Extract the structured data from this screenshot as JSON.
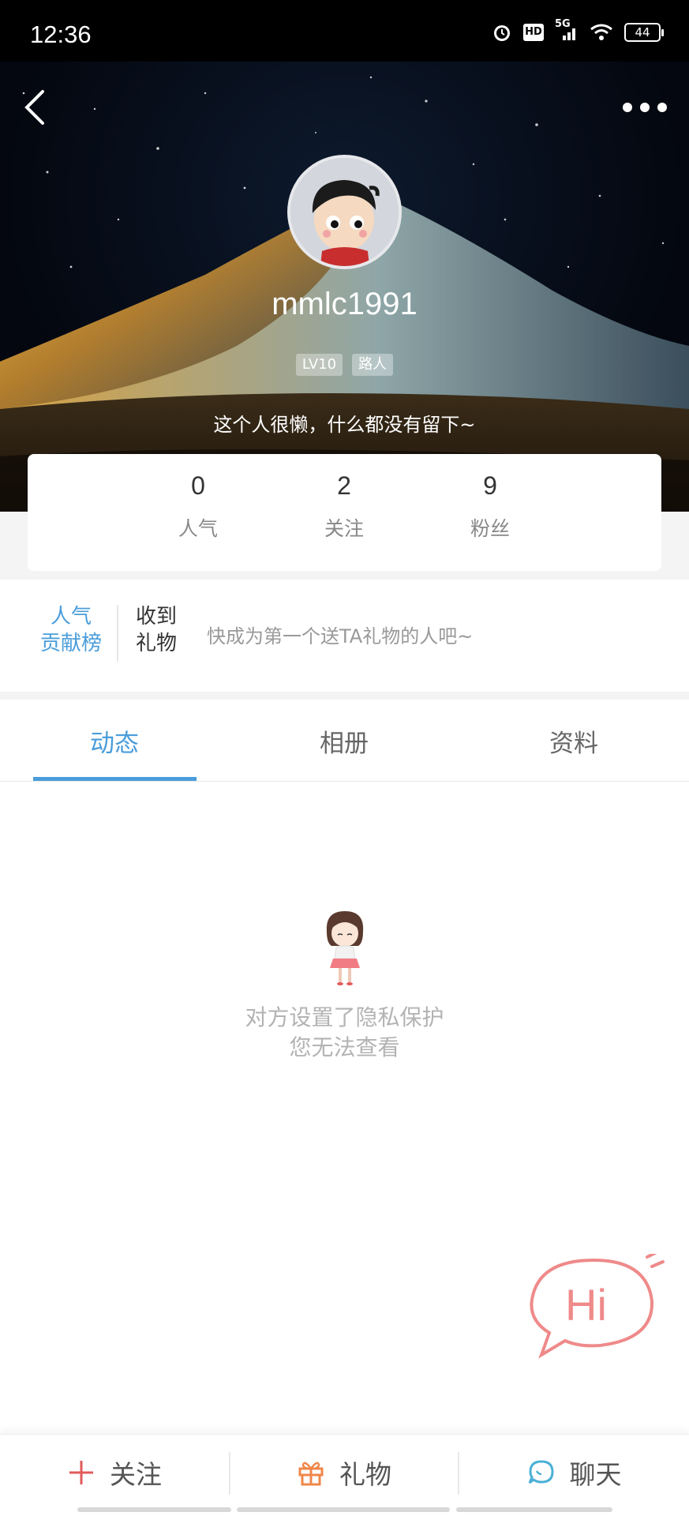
{
  "status_bar": {
    "time": "12:36",
    "network": "5G",
    "hd_label": "HD",
    "battery": "44",
    "icons": [
      "alarm-icon",
      "hd-icon",
      "signal-icon",
      "wifi-icon",
      "battery-icon"
    ]
  },
  "header": {
    "back_icon": "chevron-left-icon",
    "more_icon": "more-dots-icon",
    "username": "mmlc1991",
    "level_badge": "LV10",
    "role_badge": "路人",
    "bio": "这个人很懒，什么都没有留下~"
  },
  "stats": [
    {
      "value": "0",
      "label": "人气"
    },
    {
      "value": "2",
      "label": "关注"
    },
    {
      "value": "9",
      "label": "粉丝"
    }
  ],
  "gifts": {
    "rank_line1": "人气",
    "rank_line2": "贡献榜",
    "title_line1": "收到",
    "title_line2": "礼物",
    "hint": "快成为第一个送TA礼物的人吧~"
  },
  "tabs": [
    {
      "label": "动态",
      "active": true
    },
    {
      "label": "相册",
      "active": false
    },
    {
      "label": "资料",
      "active": false
    }
  ],
  "empty_state": {
    "line1": "对方设置了隐私保护",
    "line2": "您无法查看"
  },
  "hi_bubble": {
    "label": "Hi"
  },
  "bottom_bar": {
    "follow_label": "关注",
    "gift_label": "礼物",
    "chat_label": "聊天"
  },
  "colors": {
    "accent": "#4a9ddb",
    "hi_pink": "#ef8a8a",
    "follow_red": "#e25b5b",
    "gift_orange": "#f0874a"
  }
}
